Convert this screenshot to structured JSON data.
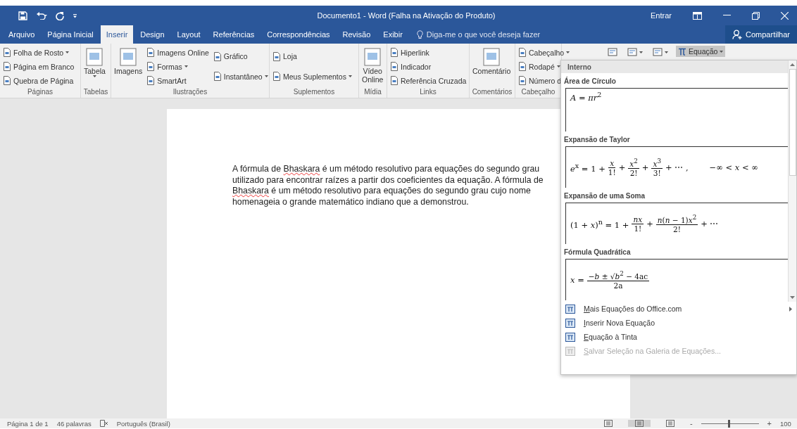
{
  "window": {
    "title": "Documento1  -  Word (Falha na Ativação do Produto)",
    "sign_in": "Entrar"
  },
  "tabs": [
    {
      "label": "Arquivo",
      "selected": false
    },
    {
      "label": "Página Inicial",
      "selected": false
    },
    {
      "label": "Inserir",
      "selected": true
    },
    {
      "label": "Design",
      "selected": false
    },
    {
      "label": "Layout",
      "selected": false
    },
    {
      "label": "Referências",
      "selected": false
    },
    {
      "label": "Correspondências",
      "selected": false
    },
    {
      "label": "Revisão",
      "selected": false
    },
    {
      "label": "Exibir",
      "selected": false
    }
  ],
  "tell_me": {
    "placeholder": "Diga-me o que você deseja fazer"
  },
  "share": "Compartilhar",
  "ribbon": {
    "groups": [
      {
        "label": "Páginas",
        "columns": [
          {
            "kind": "stack",
            "items": [
              {
                "label": "Folha de Rosto",
                "dropdown": true
              },
              {
                "label": "Página em Branco",
                "dropdown": false
              },
              {
                "label": "Quebra de Página",
                "dropdown": false
              }
            ]
          }
        ]
      },
      {
        "label": "Tabelas",
        "columns": [
          {
            "kind": "large",
            "lines": [
              "Tabela"
            ],
            "dropdown": true
          }
        ]
      },
      {
        "label": "Ilustrações",
        "columns": [
          {
            "kind": "large",
            "lines": [
              "Imagens"
            ],
            "dropdown": false
          },
          {
            "kind": "stack",
            "items": [
              {
                "label": "Imagens Online",
                "dropdown": false
              },
              {
                "label": "Formas",
                "dropdown": true
              },
              {
                "label": "SmartArt",
                "dropdown": false
              }
            ]
          },
          {
            "kind": "stack",
            "items": [
              {
                "label": "Gráfico",
                "dropdown": false
              },
              {
                "label": "Instantâneo",
                "dropdown": true
              }
            ]
          }
        ]
      },
      {
        "label": "Suplementos",
        "columns": [
          {
            "kind": "stack",
            "items": [
              {
                "label": "Loja",
                "dropdown": false
              },
              {
                "label": "Meus Suplementos",
                "dropdown": true
              }
            ]
          }
        ]
      },
      {
        "label": "Mídia",
        "columns": [
          {
            "kind": "large",
            "lines": [
              "Vídeo",
              "Online"
            ],
            "dropdown": false
          }
        ]
      },
      {
        "label": "Links",
        "columns": [
          {
            "kind": "stack",
            "items": [
              {
                "label": "Hiperlink",
                "dropdown": false
              },
              {
                "label": "Indicador",
                "dropdown": false
              },
              {
                "label": "Referência Cruzada",
                "dropdown": false
              }
            ]
          }
        ]
      },
      {
        "label": "Comentários",
        "columns": [
          {
            "kind": "large",
            "lines": [
              "Comentário"
            ],
            "dropdown": false
          }
        ]
      },
      {
        "label": "Cabeçalho",
        "columns": [
          {
            "kind": "stack",
            "items": [
              {
                "label": "Cabeçalho",
                "dropdown": true
              },
              {
                "label": "Rodapé",
                "dropdown": true
              },
              {
                "label": "Número d",
                "dropdown": false
              }
            ]
          }
        ]
      }
    ],
    "tools": [
      {
        "kind": "icon",
        "dropdown": false,
        "selected": false
      },
      {
        "kind": "icon",
        "dropdown": true,
        "selected": false
      },
      {
        "kind": "icon",
        "dropdown": true,
        "selected": false
      },
      {
        "kind": "labeled",
        "label": "Equação",
        "dropdown": true,
        "selected": true
      }
    ]
  },
  "document": {
    "paragraph": [
      {
        "text": "A fórmula de ",
        "misspelled": false
      },
      {
        "text": "Bhaskara",
        "misspelled": true
      },
      {
        "text": " é um método resolutivo para equações do segundo grau utilizado para encontrar raízes a partir dos coeficientes da equação. A fórmula de ",
        "misspelled": false
      },
      {
        "text": "Bhaskara",
        "misspelled": true
      },
      {
        "text": " é um método resolutivo para equações do segundo grau cujo nome homenageia o grande matemático indiano que a demonstrou.",
        "misspelled": false
      }
    ]
  },
  "equation_menu": {
    "header": "Interno",
    "gallery": [
      {
        "title": "Área de Círculo",
        "equation": [
          {
            "kind": "text",
            "text": "*A* = *πr*$^{2}$"
          }
        ]
      },
      {
        "title": "Expansão de Taylor",
        "equation": [
          {
            "kind": "text",
            "text": "*e*$^{x}$ = 1 +"
          },
          {
            "kind": "frac",
            "num": "*x*",
            "den": "1!"
          },
          {
            "kind": "text",
            "text": "+"
          },
          {
            "kind": "frac",
            "num": "*x*$^{2}$",
            "den": "2!"
          },
          {
            "kind": "text",
            "text": "+"
          },
          {
            "kind": "frac",
            "num": "*x*$^{3}$",
            "den": "3!"
          },
          {
            "kind": "text",
            "text": "+ ⋯ ,"
          },
          {
            "kind": "gap",
            "text": "−∞ < *x* < ∞"
          }
        ]
      },
      {
        "title": "Expansão de uma Soma",
        "equation": [
          {
            "kind": "text",
            "text": "(1 + *x*)$^{n}$ = 1 +"
          },
          {
            "kind": "frac",
            "num": "*nx*",
            "den": "1!"
          },
          {
            "kind": "text",
            "text": "+"
          },
          {
            "kind": "frac",
            "num": "*n*(*n* − 1)*x*$^{2}$",
            "den": "2!"
          },
          {
            "kind": "text",
            "text": "+ ⋯"
          }
        ]
      },
      {
        "title": "Fórmula Quadrática",
        "equation": [
          {
            "kind": "text",
            "text": "*x* ="
          },
          {
            "kind": "frac",
            "num": "−*b* ± √*b*$^{2}$ − 4ac",
            "den": "2a"
          }
        ]
      }
    ],
    "commands": [
      {
        "label": "Mais Equações do Office.com",
        "disabled": false,
        "submenu": true
      },
      {
        "label": "Inserir Nova Equação",
        "disabled": false,
        "submenu": false
      },
      {
        "label": "Equação à Tinta",
        "disabled": false,
        "submenu": false
      },
      {
        "label": "Salvar Seleção na Galeria de Equações...",
        "disabled": true,
        "submenu": false
      }
    ]
  },
  "status_bar": {
    "page": "Página 1 de 1",
    "words": "46 palavras",
    "language": "Português (Brasil)",
    "views": [
      {
        "selected": false
      },
      {
        "selected": true
      },
      {
        "selected": false
      }
    ],
    "zoom_minus": "-",
    "zoom_plus": "+",
    "zoom": {
      "level": 0.48
    },
    "zoom_label": "100"
  }
}
